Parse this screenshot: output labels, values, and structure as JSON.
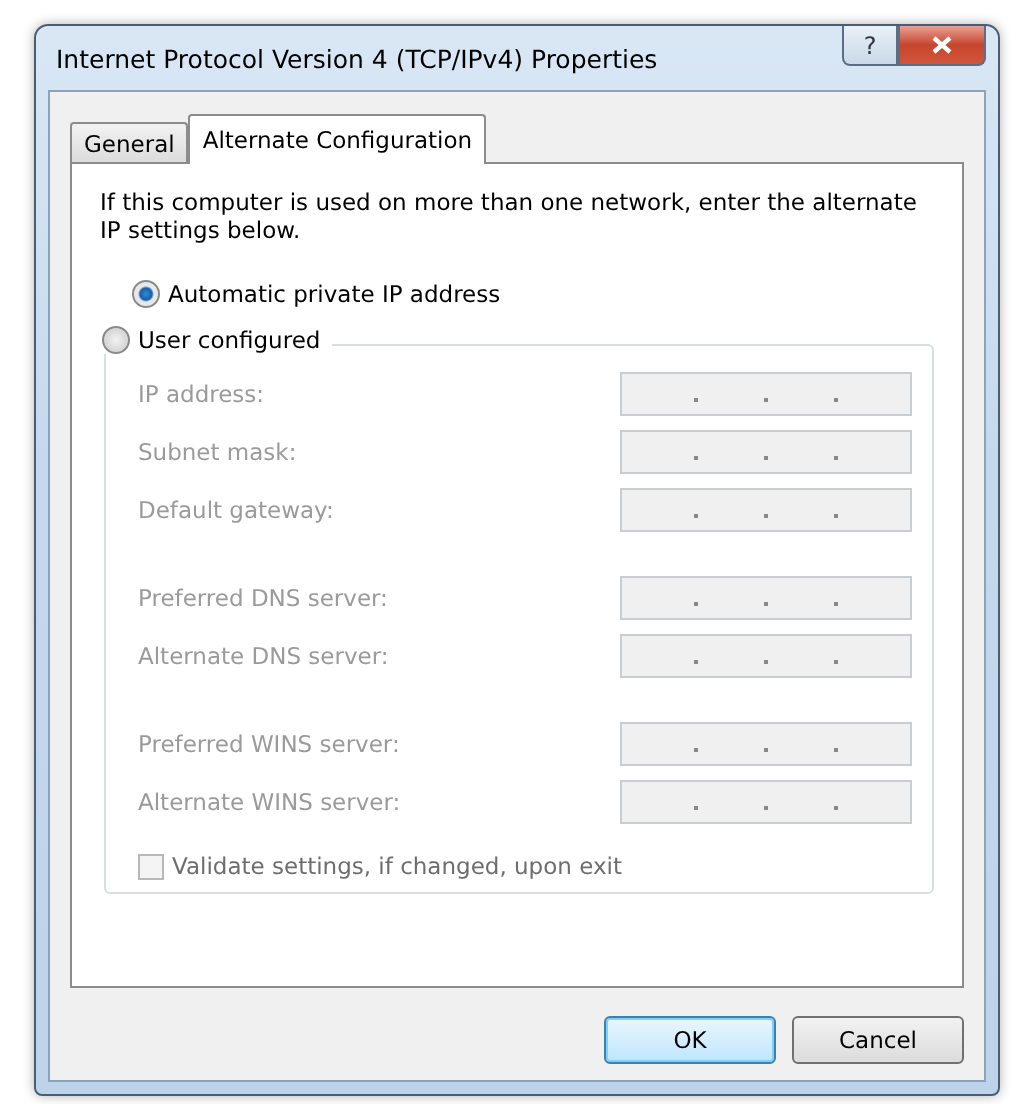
{
  "window": {
    "title": "Internet Protocol Version 4 (TCP/IPv4) Properties",
    "controls": [
      {
        "kind": "help",
        "label": "?"
      },
      {
        "kind": "close"
      }
    ]
  },
  "tabs": [
    {
      "label": "General",
      "selected": false
    },
    {
      "label": "Alternate Configuration",
      "selected": true
    }
  ],
  "intro": "If this computer is used on more than one network, enter the alternate IP settings below.",
  "options": [
    {
      "label": "Automatic private IP address",
      "selected": true
    },
    {
      "label": "User configured",
      "selected": false
    }
  ],
  "field_groups": [
    {
      "fields": [
        {
          "label": "IP address:",
          "disabled": true
        },
        {
          "label": "Subnet mask:",
          "disabled": true
        },
        {
          "label": "Default gateway:",
          "disabled": true
        }
      ]
    },
    {
      "fields": [
        {
          "label": "Preferred DNS server:",
          "disabled": true
        },
        {
          "label": "Alternate DNS server:",
          "disabled": true
        }
      ]
    },
    {
      "fields": [
        {
          "label": "Preferred WINS server:",
          "disabled": true
        },
        {
          "label": "Alternate WINS server:",
          "disabled": true
        }
      ]
    }
  ],
  "validate": {
    "label": "Validate settings, if changed, upon exit",
    "checked": false,
    "disabled": true
  },
  "buttons": [
    {
      "label": "OK",
      "default": true
    },
    {
      "label": "Cancel",
      "default": false
    }
  ]
}
